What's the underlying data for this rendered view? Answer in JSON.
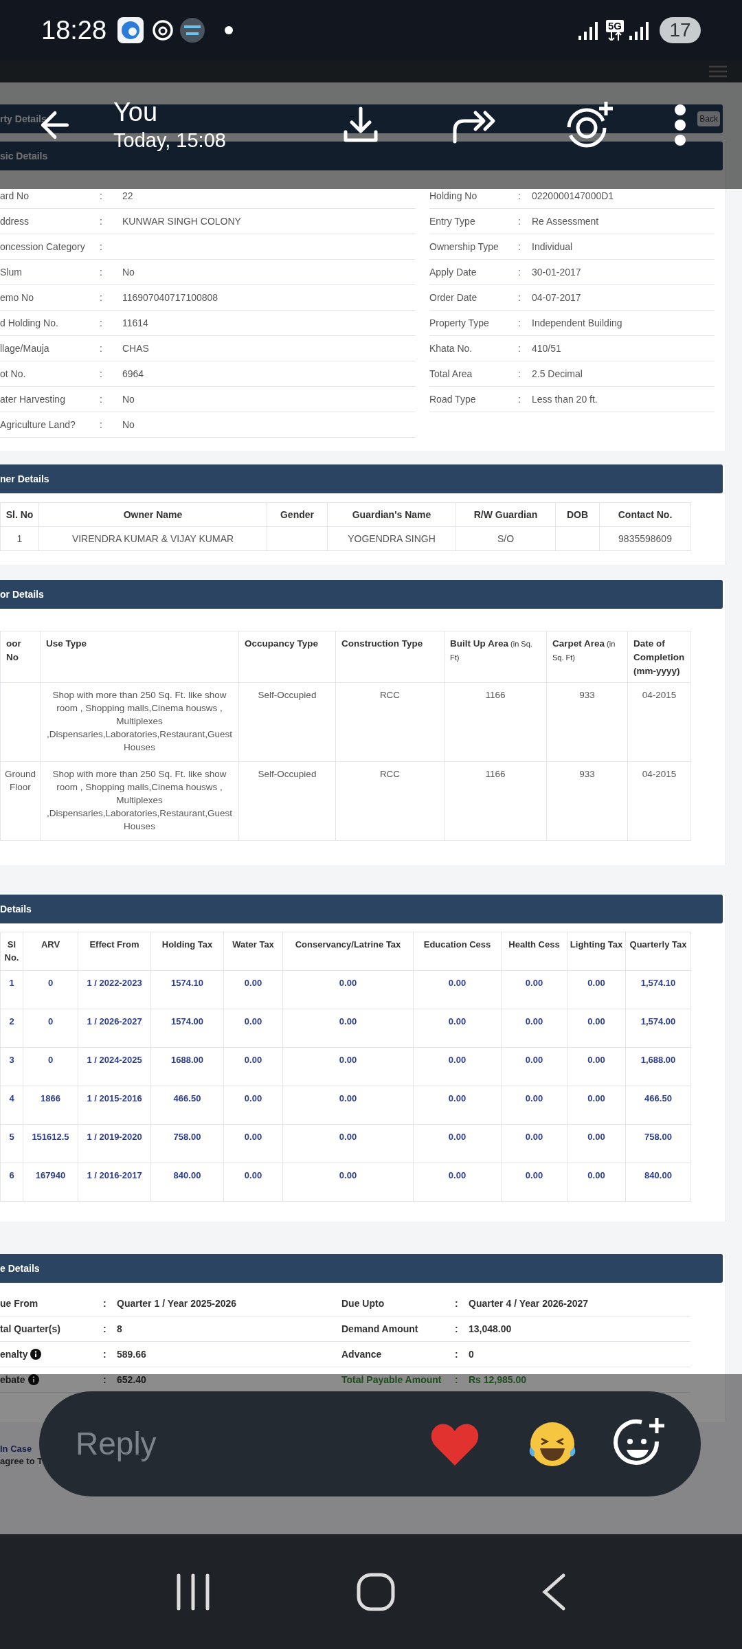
{
  "status_bar": {
    "time": "18:28",
    "network": "5G",
    "battery": "17"
  },
  "viewer": {
    "sender": "You",
    "timestamp": "Today, 15:08"
  },
  "page_header": {
    "title": "rty Details",
    "back": "Back"
  },
  "basic_details": {
    "title": "sic Details",
    "left": [
      {
        "label": "ard No",
        "sep": ":",
        "value": "22"
      },
      {
        "label": "ddress",
        "sep": ":",
        "value": "KUNWAR SINGH COLONY"
      },
      {
        "label": "oncession Category",
        "sep": ":"
      },
      {
        "label": "Slum",
        "sep": ":",
        "value": "No"
      },
      {
        "label": "emo No",
        "sep": ":",
        "value": "116907040717100808"
      },
      {
        "label": "d Holding No.",
        "sep": ":",
        "value": "11614"
      },
      {
        "label": "llage/Mauja",
        "sep": ":",
        "value": "CHAS"
      },
      {
        "label": "ot No.",
        "sep": ":",
        "value": "6964"
      },
      {
        "label": "ater Harvesting",
        "sep": ":",
        "value": "No"
      },
      {
        "label": "Agriculture Land?",
        "sep": ":",
        "value": "No"
      }
    ],
    "right": [
      {
        "label": "Holding No",
        "sep": ":",
        "value": "0220000147000D1"
      },
      {
        "label": "Entry Type",
        "sep": ":",
        "value": "Re Assessment"
      },
      {
        "label": "Ownership Type",
        "sep": ":",
        "value": "Individual"
      },
      {
        "label": "Apply Date",
        "sep": ":",
        "value": "30-01-2017"
      },
      {
        "label": "Order Date",
        "sep": ":",
        "value": "04-07-2017"
      },
      {
        "label": "Property Type",
        "sep": ":",
        "value": "Independent Building"
      },
      {
        "label": "Khata No.",
        "sep": ":",
        "value": "410/51"
      },
      {
        "label": "Total Area",
        "sep": ":",
        "value": "2.5 Decimal"
      },
      {
        "label": "Road Type",
        "sep": ":",
        "value": "Less than 20 ft."
      }
    ]
  },
  "owner_details": {
    "title": "ner Details",
    "columns": [
      "Sl. No",
      "Owner Name",
      "Gender",
      "Guardian's Name",
      "R/W Guardian",
      "DOB",
      "Contact No."
    ],
    "rows": [
      [
        "1",
        "VIRENDRA KUMAR & VIJAY KUMAR",
        null,
        "YOGENDRA SINGH",
        "S/O",
        null,
        "9835598609"
      ]
    ]
  },
  "floor_details": {
    "title": "or Details",
    "columns": [
      {
        "label": "oor No"
      },
      {
        "label": "Use Type"
      },
      {
        "label": "Occupancy Type"
      },
      {
        "label": "Construction Type"
      },
      {
        "label": "Built Up Area",
        "unit": "(in Sq. Ft)"
      },
      {
        "label": "Carpet Area",
        "unit": "(in Sq. Ft)"
      },
      {
        "label": "Date of Completion (mm-yyyy)"
      }
    ],
    "rows": [
      [
        null,
        "Shop with more than 250 Sq. Ft. like show room , Shopping malls,Cinema housws , Multiplexes ,Dispensaries,Laboratories,Restaurant,Guest Houses",
        "Self-Occupied",
        "RCC",
        "1166",
        "933",
        "04-2015"
      ],
      [
        "Ground Floor",
        "Shop with more than 250 Sq. Ft. like show room , Shopping malls,Cinema housws , Multiplexes ,Dispensaries,Laboratories,Restaurant,Guest Houses",
        "Self-Occupied",
        "RCC",
        "1166",
        "933",
        "04-2015"
      ]
    ]
  },
  "tax_details": {
    "title": "Details",
    "columns": [
      "Sl No.",
      "ARV",
      "Effect From",
      "Holding Tax",
      "Water Tax",
      "Conservancy/Latrine Tax",
      "Education Cess",
      "Health Cess",
      "Lighting Tax",
      "Quarterly Tax"
    ],
    "rows": [
      [
        "1",
        "0",
        "1 / 2022-2023",
        "1574.10",
        "0.00",
        "0.00",
        "0.00",
        "0.00",
        "0.00",
        "1,574.10"
      ],
      [
        "2",
        "0",
        "1 / 2026-2027",
        "1574.00",
        "0.00",
        "0.00",
        "0.00",
        "0.00",
        "0.00",
        "1,574.00"
      ],
      [
        "3",
        "0",
        "1 / 2024-2025",
        "1688.00",
        "0.00",
        "0.00",
        "0.00",
        "0.00",
        "0.00",
        "1,688.00"
      ],
      [
        "4",
        "1866",
        "1 / 2015-2016",
        "466.50",
        "0.00",
        "0.00",
        "0.00",
        "0.00",
        "0.00",
        "466.50"
      ],
      [
        "5",
        "151612.5",
        "1 / 2019-2020",
        "758.00",
        "0.00",
        "0.00",
        "0.00",
        "0.00",
        "0.00",
        "758.00"
      ],
      [
        "6",
        "167940",
        "1 / 2016-2017",
        "840.00",
        "0.00",
        "0.00",
        "0.00",
        "0.00",
        "0.00",
        "840.00"
      ]
    ]
  },
  "due_details": {
    "title": "e Details",
    "rows": [
      [
        {
          "label": "ue From",
          "sep": ":",
          "value": "Quarter 1 / Year 2025-2026",
          "info": false,
          "highlight": false
        },
        {
          "label": "Due Upto",
          "sep": ":",
          "value": "Quarter 4 / Year 2026-2027",
          "info": false,
          "highlight": false
        }
      ],
      [
        {
          "label": "tal Quarter(s)",
          "sep": ":",
          "value": "8",
          "info": false,
          "highlight": false
        },
        {
          "label": "Demand Amount",
          "sep": ":",
          "value": "13,048.00",
          "info": false,
          "highlight": false
        }
      ],
      [
        {
          "label": "enalty",
          "sep": ":",
          "value": "589.66",
          "info": true,
          "highlight": false
        },
        {
          "label": "Advance",
          "sep": ":",
          "value": "0",
          "info": false,
          "highlight": false
        }
      ],
      [
        {
          "label": "ebate",
          "sep": ":",
          "value": "652.40",
          "info": true,
          "highlight": false
        },
        {
          "label": "Total Payable Amount",
          "sep": ":",
          "value": "Rs 12,985.00",
          "info": false,
          "highlight": true
        }
      ]
    ]
  },
  "footer": {
    "link": "In Case",
    "text": "agree to T"
  },
  "reply": {
    "placeholder": "Reply"
  }
}
